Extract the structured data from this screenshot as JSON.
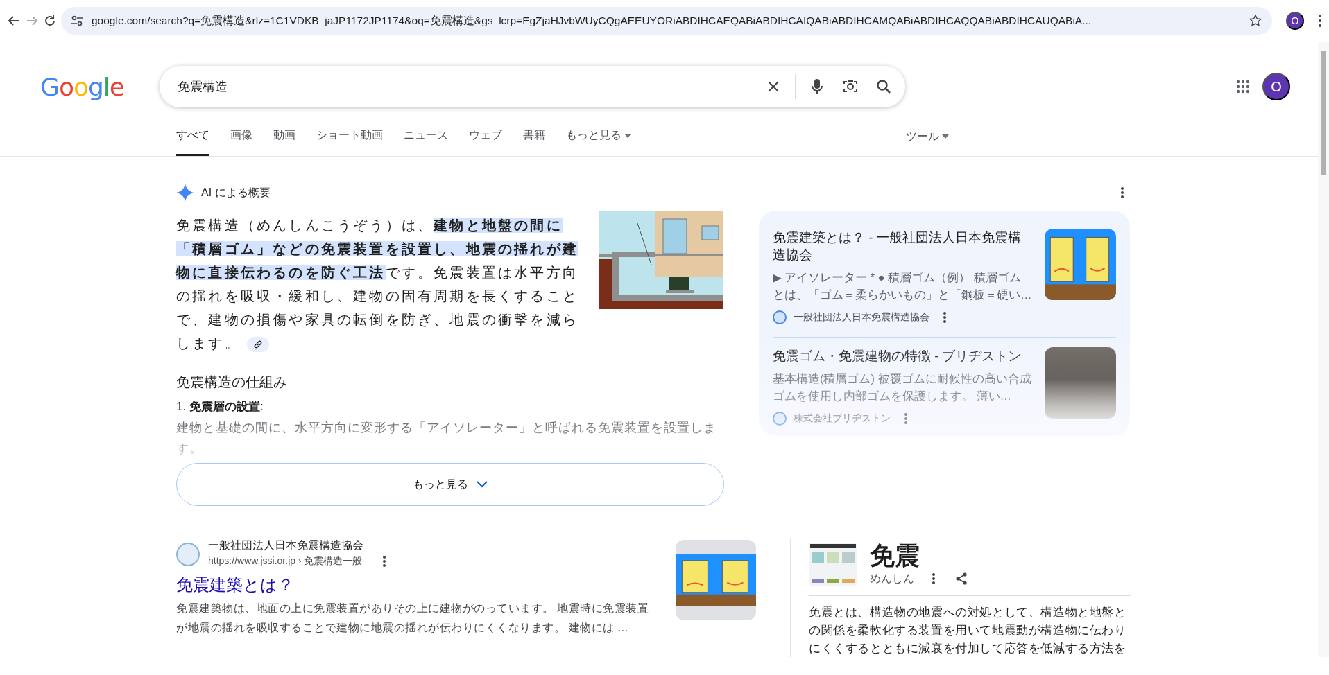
{
  "browser": {
    "url": "google.com/search?q=免震構造&rlz=1C1VDKB_jaJP1172JP1174&oq=免震構造&gs_lcrp=EgZjaHJvbWUyCQgAEEUYORiABDIHCAEQABiABDIHCAIQABiABDIHCAMQABiABDIHCAQQABiABDIHCAUQABiA...",
    "profile_initial": "O"
  },
  "header": {
    "logo": "Google",
    "search": {
      "value": "免震構造"
    },
    "avatar_initial": "O"
  },
  "tabs": [
    {
      "label": "すべて",
      "selected": true,
      "kind": "plain"
    },
    {
      "label": "画像",
      "selected": false,
      "kind": "plain"
    },
    {
      "label": "動画",
      "selected": false,
      "kind": "plain"
    },
    {
      "label": "ショート動画",
      "selected": false,
      "kind": "plain"
    },
    {
      "label": "ニュース",
      "selected": false,
      "kind": "plain"
    },
    {
      "label": "ウェブ",
      "selected": false,
      "kind": "plain"
    },
    {
      "label": "書籍",
      "selected": false,
      "kind": "plain"
    },
    {
      "label": "もっと見る",
      "selected": false,
      "kind": "dropdown"
    }
  ],
  "tools": "ツール",
  "ai_overview": {
    "title": "AI による概要",
    "paragraph": [
      {
        "text": "免震構造（めんしんこうぞう）は、",
        "highlighted": false
      },
      {
        "text": "建物と地盤の間に「積層ゴム」などの免震装置を設置し、地震の揺れが建物に直接伝わるのを防ぐ工法",
        "highlighted": true
      },
      {
        "text": "です。免震装置は水平方向の揺れを吸収・緩和し、建物の固有周期を長くすることで、建物の損傷や家具の転倒を防ぎ、地震の衝撃を減らします。",
        "highlighted": false
      }
    ],
    "heading": "免震構造の仕組み",
    "steps": [
      {
        "title": "1. **免震層の設置**:",
        "text_segments": [
          {
            "text": "建物と基礎の間に、水平方向に変形する「",
            "kind": "plain"
          },
          {
            "text": "アイソレーター",
            "kind": "term"
          },
          {
            "text": "」と呼ばれる免震装置を設置します。",
            "kind": "plain"
          }
        ]
      }
    ],
    "more_button": "もっと見る",
    "sources": [
      {
        "title": "免震建築とは？ - 一般社団法人日本免震構造協会",
        "snippet": "▶ アイソレーター * ● 積層ゴム（例） 積層ゴムとは、「ゴム＝柔らかいもの」と「鋼板＝硬い…",
        "source": "一般社団法人日本免震構造協会",
        "kind": "cartoon"
      },
      {
        "title": "免震ゴム・免震建物の特徴 - ブリヂストン",
        "snippet": "基本構造(積層ゴム) 被覆ゴムに耐候性の高い合成ゴムを使用し内部ゴムを保護します。 薄い…",
        "source": "株式会社ブリヂストン",
        "kind": "photo"
      }
    ]
  },
  "result": {
    "site": "一般社団法人日本免震構造協会",
    "url": "https://www.jssi.or.jp › 免震構造一般",
    "title": "免震建築とは？",
    "snippet": "免震建築物は、地面の上に免震装置がありその上に建物がのっています。 地震時に免震装置が地震の揺れを吸収することで建物に地震の揺れが伝わりにくくなります。 建物には ..."
  },
  "knowledge": {
    "title": "免震",
    "reading": "めんしん",
    "description": "免震とは、構造物の地震への対処として、構造物と地盤との関係を柔軟化する装置を用いて地震動が構造物に伝わりにくくするとともに減衰を付加して応答を低減する方法を"
  }
}
